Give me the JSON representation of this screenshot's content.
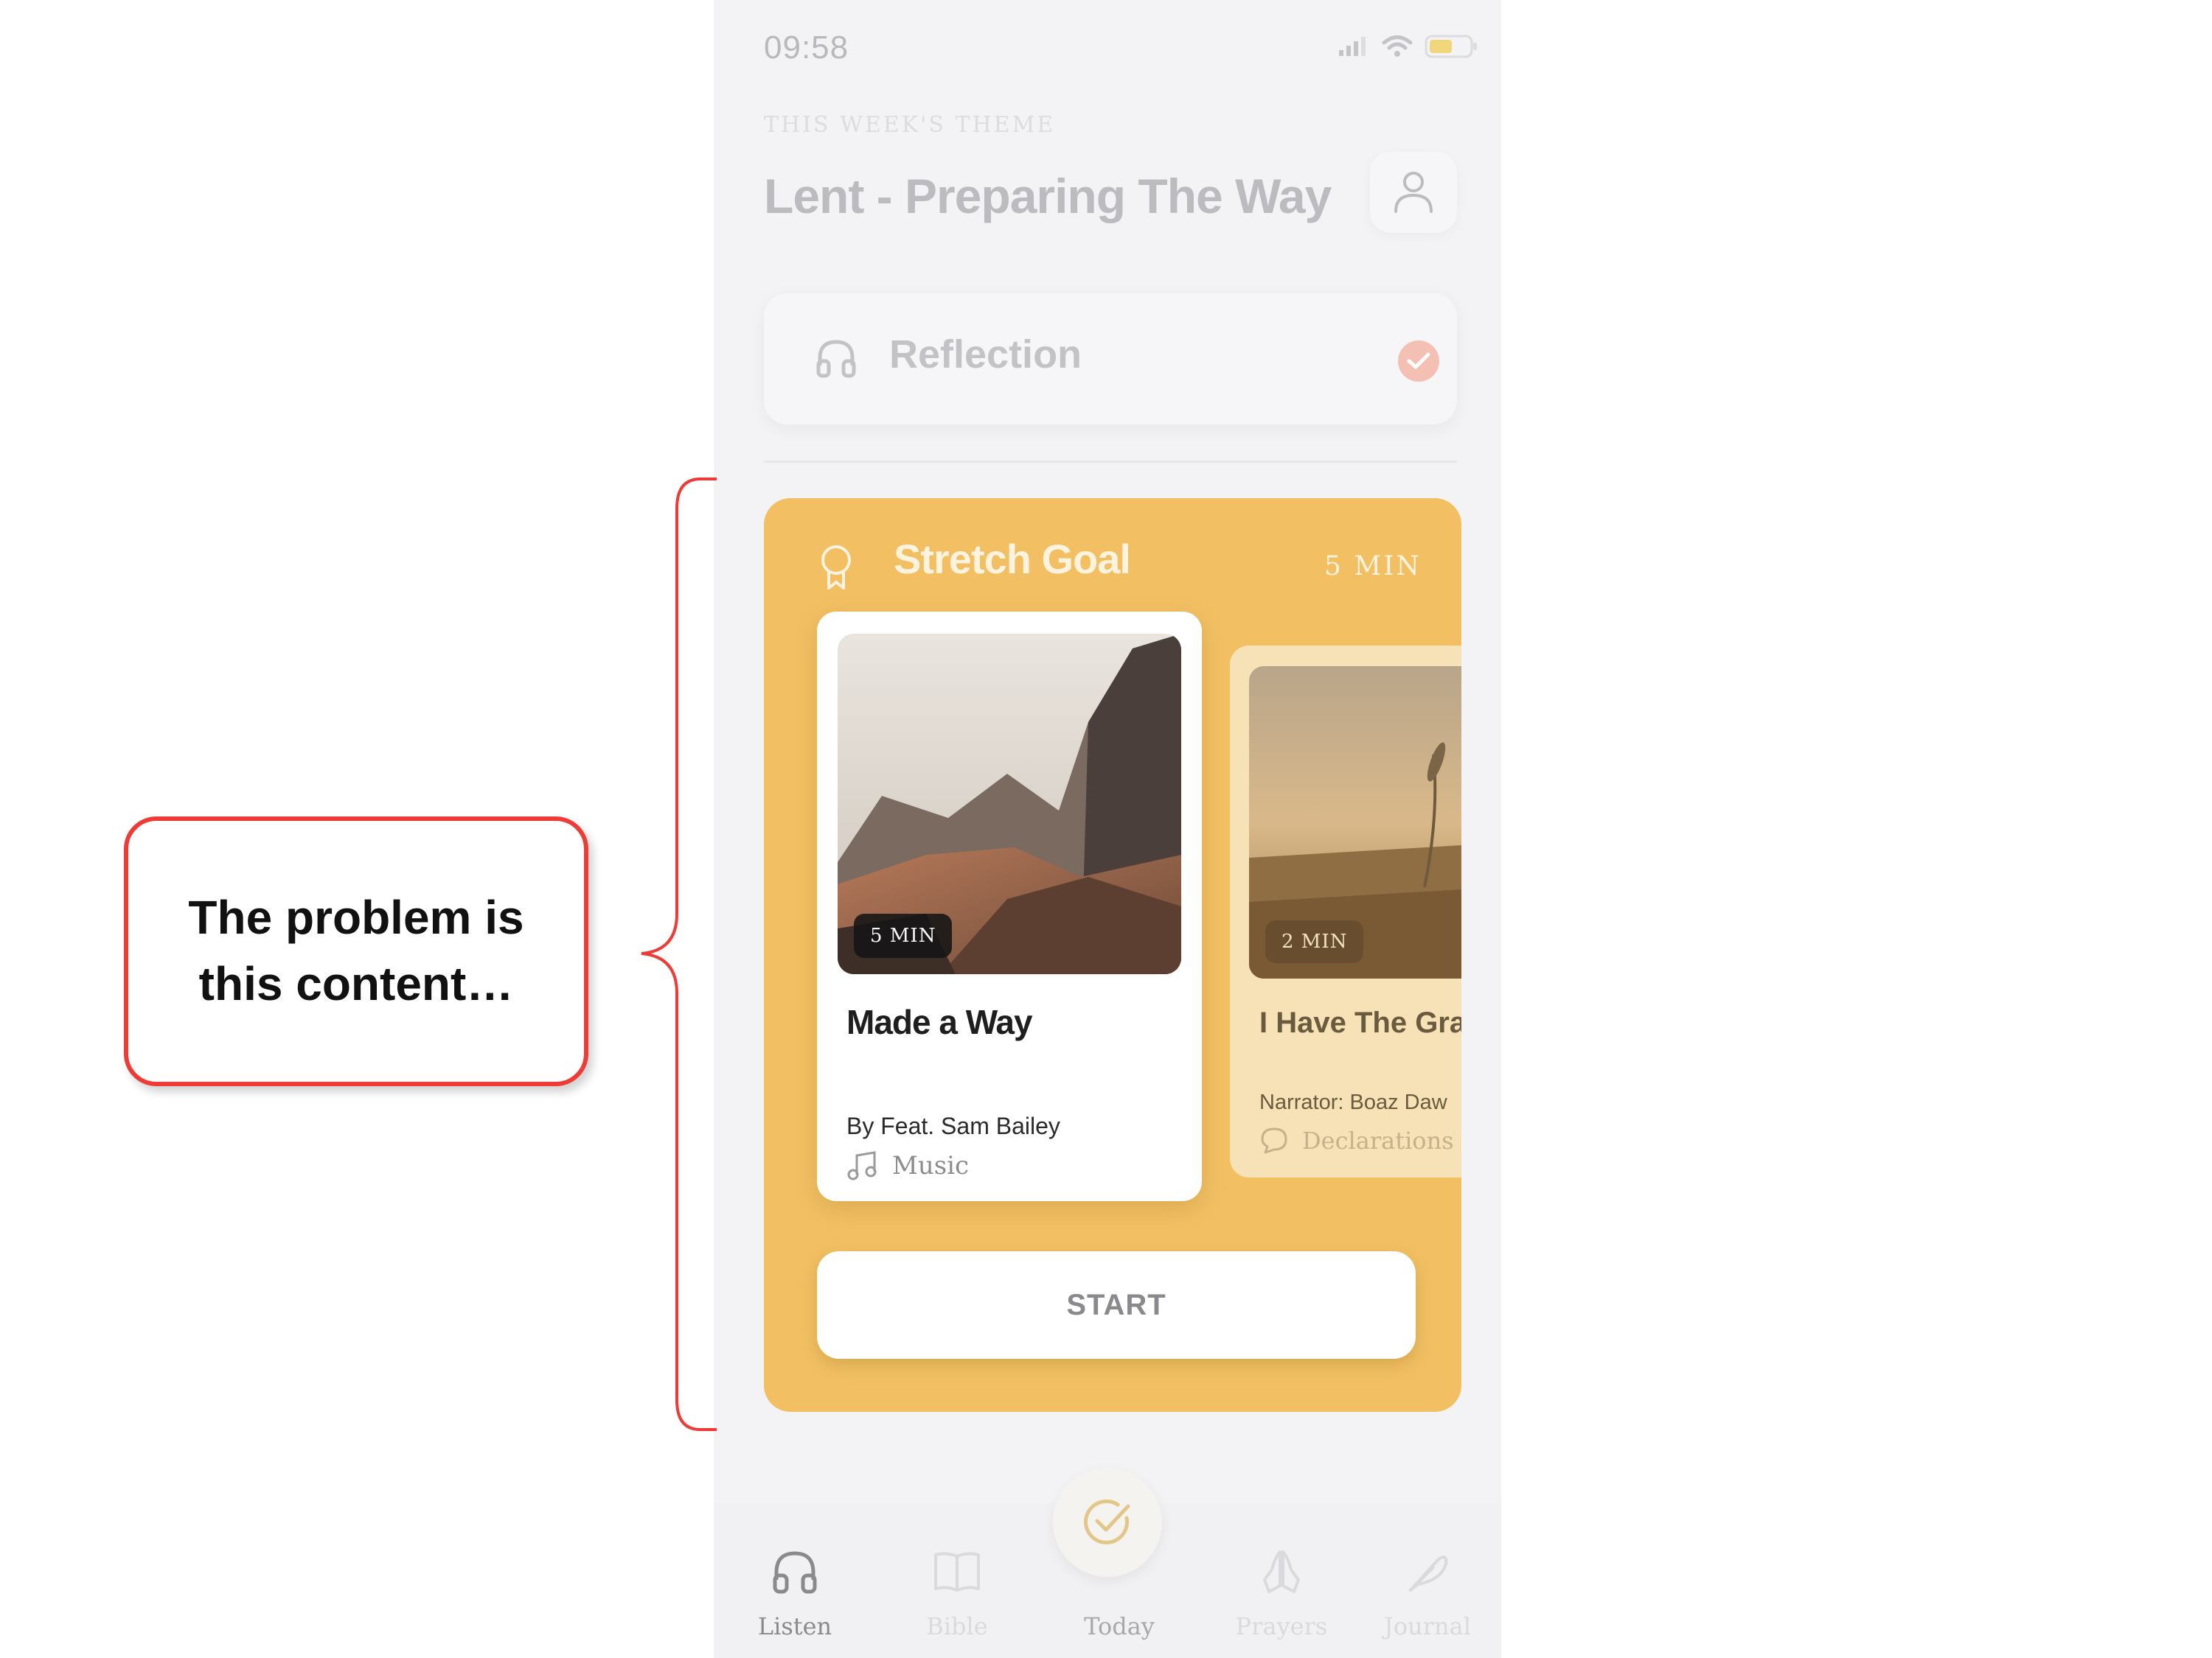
{
  "status_bar": {
    "time": "09:58"
  },
  "header": {
    "theme_label": "THIS WEEK'S THEME",
    "theme_title": "Lent - Preparing The Way"
  },
  "reflection": {
    "label": "Reflection",
    "status": "completed"
  },
  "stretch_goal": {
    "title": "Stretch Goal",
    "duration": "5 MIN",
    "tracks": [
      {
        "duration": "5 MIN",
        "title": "Made a Way",
        "author": "By Feat. Sam Bailey",
        "category": "Music",
        "icon": "music-note-icon"
      },
      {
        "duration": "2 MIN",
        "title": "I Have The Gra",
        "author": "Narrator: Boaz Daw",
        "category": "Declarations",
        "icon": "speech-bubble-icon"
      }
    ],
    "start_label": "START"
  },
  "tabbar": {
    "tabs": [
      {
        "label": "Listen",
        "icon": "headphones-icon",
        "active": true
      },
      {
        "label": "Bible",
        "icon": "book-icon",
        "active": false
      },
      {
        "label": "Today",
        "icon": "check-circle-icon",
        "active": false
      },
      {
        "label": "Prayers",
        "icon": "praying-hands-icon",
        "active": false
      },
      {
        "label": "Journal",
        "icon": "feather-icon",
        "active": false
      }
    ]
  },
  "annotation": {
    "line1": "The problem is",
    "line2": "this content…"
  },
  "colors": {
    "accent": "#f2c063",
    "annotation_border": "#ee3b36",
    "background": "#f3f3f5"
  }
}
